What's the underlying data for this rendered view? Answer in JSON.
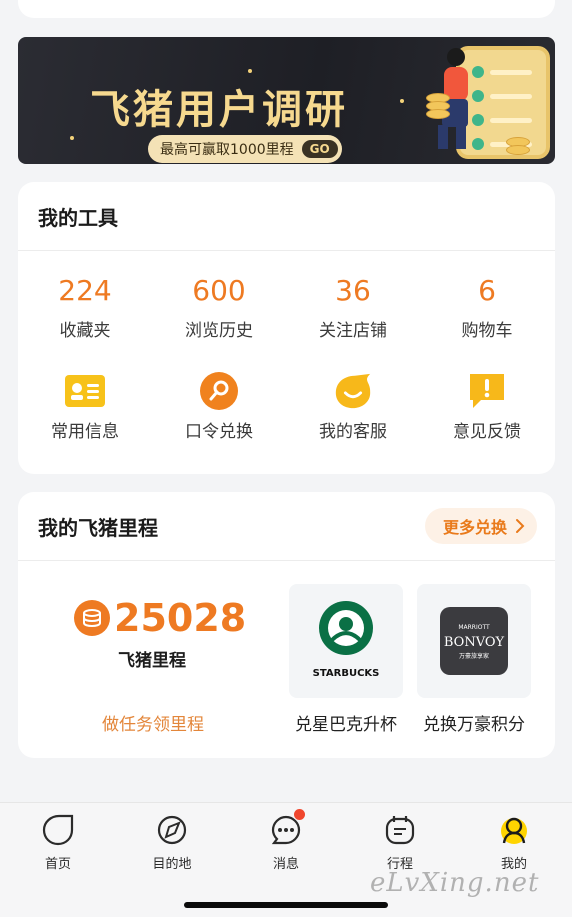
{
  "banner": {
    "title": "飞猪用户调研",
    "subtitle": "最高可赢取1000里程",
    "go_label": "GO"
  },
  "tools": {
    "title": "我的工具",
    "stats": [
      {
        "value": "224",
        "label": "收藏夹"
      },
      {
        "value": "600",
        "label": "浏览历史"
      },
      {
        "value": "36",
        "label": "关注店铺"
      },
      {
        "value": "6",
        "label": "购物车"
      }
    ],
    "items": [
      {
        "icon": "id-card-icon",
        "label": "常用信息"
      },
      {
        "icon": "key-search-icon",
        "label": "口令兑换"
      },
      {
        "icon": "customer-service-icon",
        "label": "我的客服"
      },
      {
        "icon": "feedback-icon",
        "label": "意见反馈"
      }
    ]
  },
  "miles": {
    "title": "我的飞猪里程",
    "more_label": "更多兑换",
    "amount": "25028",
    "amount_label": "飞猪里程",
    "task_link": "做任务领里程",
    "partners": [
      {
        "logo_text": "STARBUCKS",
        "label": "兑星巴克升杯"
      },
      {
        "logo_text": "BONVOY",
        "logo_top": "MARRIOTT",
        "logo_bottom": "万豪旅享家",
        "label": "兑换万豪积分"
      }
    ]
  },
  "tabbar": {
    "tabs": [
      {
        "icon": "home-icon",
        "label": "首页"
      },
      {
        "icon": "destination-icon",
        "label": "目的地"
      },
      {
        "icon": "message-icon",
        "label": "消息"
      },
      {
        "icon": "itinerary-icon",
        "label": "行程"
      },
      {
        "icon": "profile-icon",
        "label": "我的"
      }
    ]
  },
  "watermark": "eLvXing.net",
  "colors": {
    "accent": "#ee7a22",
    "banner_bg": "#1e1f25",
    "banner_gold": "#f6d98f"
  }
}
